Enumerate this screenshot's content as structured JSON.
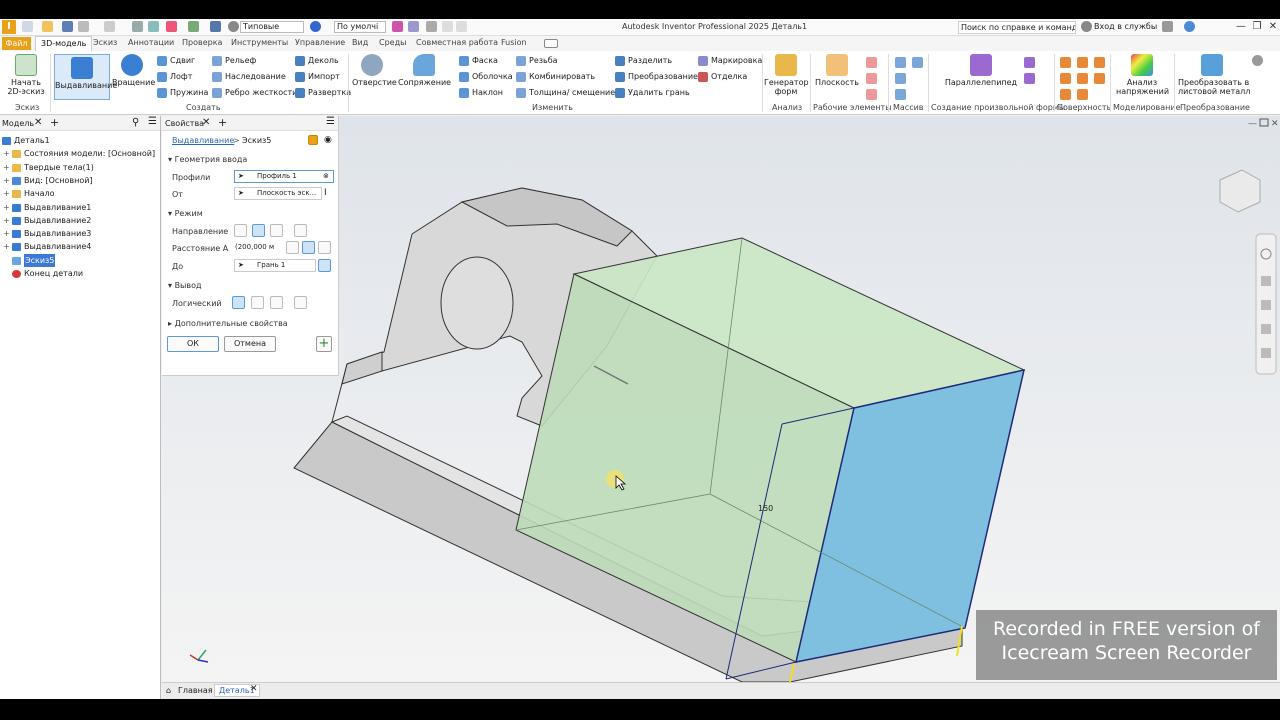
{
  "titlebar": {
    "app_title": "Autodesk Inventor Professional 2025  Деталь1",
    "material": "Типовые",
    "appearance": "По умолчі",
    "search_placeholder": "Поиск по справке и командам",
    "signin": "Вход в службы"
  },
  "menu": {
    "file": "Файл",
    "tabs": [
      "3D-модель",
      "Эскиз",
      "Аннотации",
      "Проверка",
      "Инструменты",
      "Управление",
      "Вид",
      "Среды",
      "Совместная работа",
      "Fusion"
    ]
  },
  "ribbon": {
    "sketch": {
      "start": "Начать\n2D-эскиз",
      "group": "Эскиз"
    },
    "create": {
      "extrude": "Выдавливание",
      "revolve": "Вращение",
      "sweep": "Сдвиг",
      "loft": "Лофт",
      "coil": "Пружина",
      "emboss": "Рельеф",
      "derive": "Наследование",
      "rib": "Ребро жесткости",
      "decal": "Деколь",
      "import": "Импорт",
      "unfold": "Развертка",
      "group": "Создать"
    },
    "modify": {
      "hole": "Отверстие",
      "fillet": "Сопряжение",
      "chamfer": "Фаска",
      "shell": "Оболочка",
      "draft": "Наклон",
      "thread": "Резьба",
      "combine": "Комбинировать",
      "thicken": "Толщина/ смещение",
      "split": "Разделить",
      "transform": "Преобразование",
      "delete_face": "Удалить грань",
      "mark": "Маркировка",
      "direct": "Отделка",
      "group": "Изменить"
    },
    "explore": {
      "generator": "Генератор\nформ",
      "group": "Анализ"
    },
    "work": {
      "plane": "Плоскость",
      "group": "Рабочие элементы"
    },
    "pattern": {
      "group": "Массив"
    },
    "freeform": {
      "box": "Параллелепипед",
      "group": "Создание произвольной формы"
    },
    "surface": {
      "group": "Поверхность"
    },
    "simulation": {
      "stress": "Анализ\nнапряжений",
      "group": "Моделирование"
    },
    "convert": {
      "sheet": "Преобразовать в\nлистовой металл",
      "group": "Преобразование"
    }
  },
  "browser": {
    "tab": "Модель",
    "items": [
      {
        "label": "Деталь1",
        "color": "#3a7bd5"
      },
      {
        "label": "Состояния модели: [Основной]",
        "color": "#e8b84a"
      },
      {
        "label": "Твердые тела(1)",
        "color": "#e8b84a"
      },
      {
        "label": "Вид: [Основной]",
        "color": "#4a8ad8"
      },
      {
        "label": "Начало",
        "color": "#e8b84a"
      },
      {
        "label": "Выдавливание1",
        "color": "#3a7bd5"
      },
      {
        "label": "Выдавливание2",
        "color": "#3a7bd5"
      },
      {
        "label": "Выдавливание3",
        "color": "#3a7bd5"
      },
      {
        "label": "Выдавливание4",
        "color": "#3a7bd5"
      },
      {
        "label": "Эскиз5",
        "color": "#6aa7e0"
      },
      {
        "label": "Конец детали",
        "color": "#d83a3a"
      }
    ]
  },
  "props": {
    "tab": "Свойства",
    "breadcrumb_op": "Выдавливание",
    "breadcrumb_sketch": "Эскиз5",
    "sec_input": "Геометрия ввода",
    "profiles_label": "Профили",
    "profiles_value": "Профиль 1",
    "from_label": "От",
    "from_value": "Плоскость эск...",
    "sec_mode": "Режим",
    "direction_label": "Направление",
    "distance_label": "Расстояние А",
    "distance_value": "(200,000 м",
    "to_label": "До",
    "to_value": "Грань 1",
    "sec_output": "Вывод",
    "boolean_label": "Логический",
    "sec_advanced": "Дополнительные свойства",
    "ok": "ОК",
    "cancel": "Отмена"
  },
  "viewport": {
    "dimension": "150"
  },
  "bottom": {
    "home": "Главная",
    "doc": "Деталь1"
  },
  "watermark": {
    "line1": "Recorded in FREE version of",
    "line2": "Icecream   Screen   Recorder"
  },
  "colors": {
    "accent": "#e8a21a",
    "preview_green": "#c8e6c0",
    "face_blue": "#7fc0e0"
  }
}
